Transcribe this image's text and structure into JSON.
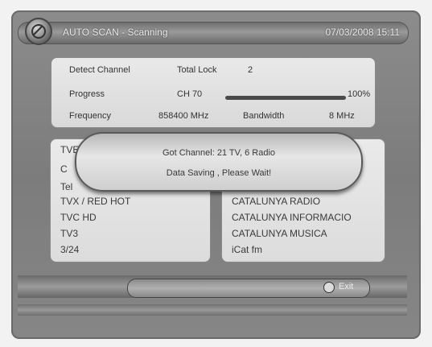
{
  "header": {
    "title": "AUTO SCAN - Scanning",
    "datetime": "07/03/2008 15:11"
  },
  "scan_info": {
    "detect_channel_label": "Detect Channel",
    "total_lock_label": "Total Lock",
    "total_lock_value": "2",
    "progress_label": "Progress",
    "channel_value": "CH 70",
    "progress_percent_text": "100%",
    "progress_fraction": 1.0,
    "frequency_label": "Frequency",
    "frequency_value": "858400 MHz",
    "bandwidth_label": "Bandwidth",
    "bandwidth_value": "8 MHz"
  },
  "tv_list": [
    "TVE",
    "C",
    "Tel",
    "TVX / RED HOT",
    "TVC HD",
    "TV3",
    "3/24"
  ],
  "radio_list": [
    "CATALUNYA RADIO",
    "CATALUNYA INFORMACIO",
    "CATALUNYA MUSICA",
    "iCat fm"
  ],
  "popup": {
    "line1": "Got Channel: 21 TV,  6 Radio",
    "line2": "Data Saving , Please Wait!"
  },
  "footer": {
    "exit_label": "Exit"
  },
  "colors": {
    "background": "#7f7f7f",
    "panel": "#e2e2e2",
    "text": "#333333"
  }
}
